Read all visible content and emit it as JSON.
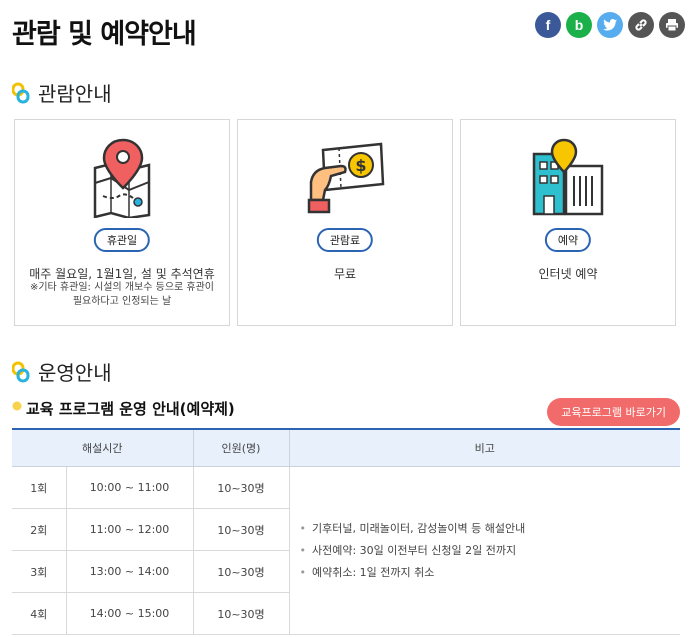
{
  "page": {
    "title": "관람 및 예약안내"
  },
  "share": [
    {
      "label": "f",
      "icon": "facebook-icon",
      "color": "#3b5998"
    },
    {
      "label": "b",
      "icon": "blog-icon",
      "color": "#1bb04a"
    },
    {
      "label": "t",
      "icon": "twitter-icon",
      "color": "#55acee"
    },
    {
      "label": "",
      "icon": "link-icon",
      "color": "#555555"
    },
    {
      "label": "",
      "icon": "print-icon",
      "color": "#555555"
    }
  ],
  "section1": {
    "title": "관람안내"
  },
  "cards": [
    {
      "badge": "휴관일",
      "text": "매주 월요일, 1월1일, 설 및 추석연휴",
      "note": "※기타 휴관일: 시설의 개보수 등으로 휴관이 필요하다고 인정되는 날",
      "icon": "map-pin-icon"
    },
    {
      "badge": "관람료",
      "text": "무료",
      "note": "",
      "icon": "ticket-hand-icon"
    },
    {
      "badge": "예약",
      "text": "인터넷 예약",
      "note": "",
      "icon": "building-pin-icon"
    }
  ],
  "section2": {
    "title": "운영안내"
  },
  "program": {
    "title": "교육 프로그램 운영 안내(예약제)",
    "button": "교육프로그램 바로가기",
    "headers": {
      "time": "해설시간",
      "people": "인원(명)",
      "notes": "비고"
    },
    "rows": [
      {
        "no": "1회",
        "time": "10:00 ~ 11:00",
        "people": "10~30명"
      },
      {
        "no": "2회",
        "time": "11:00 ~ 12:00",
        "people": "10~30명"
      },
      {
        "no": "3회",
        "time": "13:00 ~ 14:00",
        "people": "10~30명"
      },
      {
        "no": "4회",
        "time": "14:00 ~ 15:00",
        "people": "10~30명"
      }
    ],
    "notes": [
      "기후터널, 미래놀이터, 감성놀이벽 등 해설안내",
      "사전예약: 30일 이전부터 신청일 2일 전까지",
      "예약취소: 1일 전까지 취소"
    ]
  }
}
